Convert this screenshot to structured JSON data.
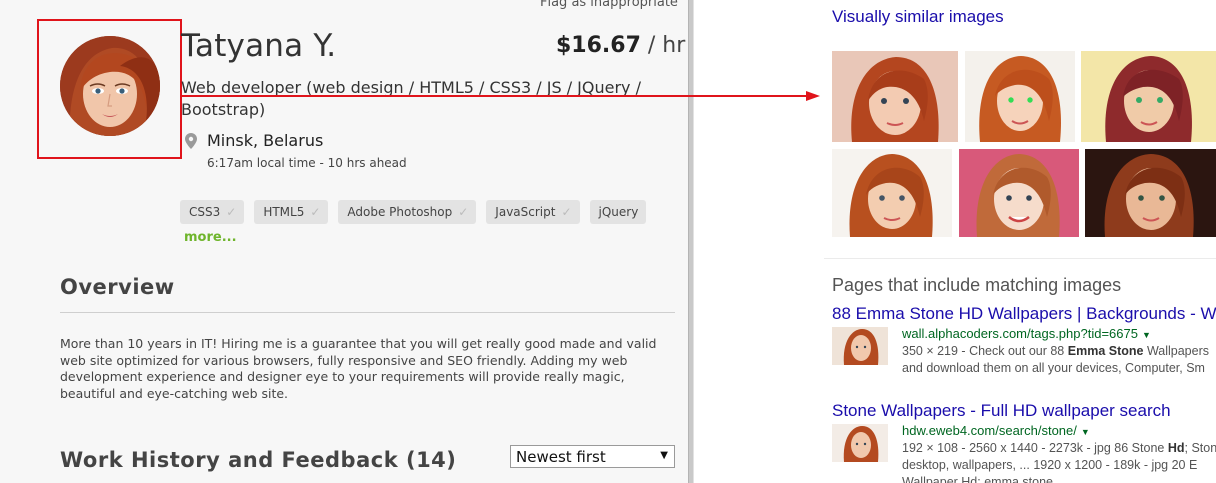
{
  "profile": {
    "flag_link": "Flag as inappropriate",
    "name": "Tatyana Y.",
    "rate_amount": "$16.67",
    "rate_unit": " / hr",
    "title": "Web developer (web design / HTML5 / CSS3  / JS / JQuery / Bootstrap)",
    "location": "Minsk, Belarus",
    "local_time": "6:17am local time - 10 hrs ahead",
    "skills": [
      "CSS3",
      "HTML5",
      "Adobe Photoshop",
      "JavaScript",
      "jQuery"
    ],
    "more_link": "more...",
    "annotation_color": "#e0141b"
  },
  "overview": {
    "heading": "Overview",
    "text": "More than 10 years in IT! Hiring me is a guarantee that you will get really good made and valid web site optimized for various browsers, fully responsive  and SEO friendly. Adding my web development experience and designer eye to your requirements will provide really magic, beautiful and eye-catching web site."
  },
  "work_history": {
    "heading": "Work History and Feedback (14)",
    "sort_selected": "Newest first"
  },
  "search": {
    "similar_heading": "Visually similar images",
    "pages_heading": "Pages that include matching images",
    "results": [
      {
        "title": "88 Emma Stone HD Wallpapers | Backgrounds - W",
        "url": "wall.alphacoders.com/tags.php?tid=6675",
        "desc_line1_pre": "350 × 219 - Check out our 88 ",
        "desc_line1_bold": "Emma Stone",
        "desc_line1_post": " Wallpapers",
        "desc_line2": "and download them on all your devices, Computer, Sm"
      },
      {
        "title": "Stone Wallpapers - Full HD wallpaper search",
        "url": "hdw.eweb4.com/search/stone/",
        "desc_line1_pre": "192 × 108 - 2560 x 1440 - 2273k - jpg 86 Stone ",
        "desc_line1_bold": "Hd",
        "desc_line1_post": "; Stone",
        "desc_line2": "desktop, wallpapers, ... 1920 x 1200 - 189k - jpg 20 E",
        "desc_line3": "Wallpaper Hd: emma stone"
      }
    ]
  },
  "icons": {
    "location": "map-pin-icon",
    "skill_check": "checkmark-icon",
    "dropdown": "chevron-down-icon",
    "url_dropdown": "triangle-down-icon"
  }
}
